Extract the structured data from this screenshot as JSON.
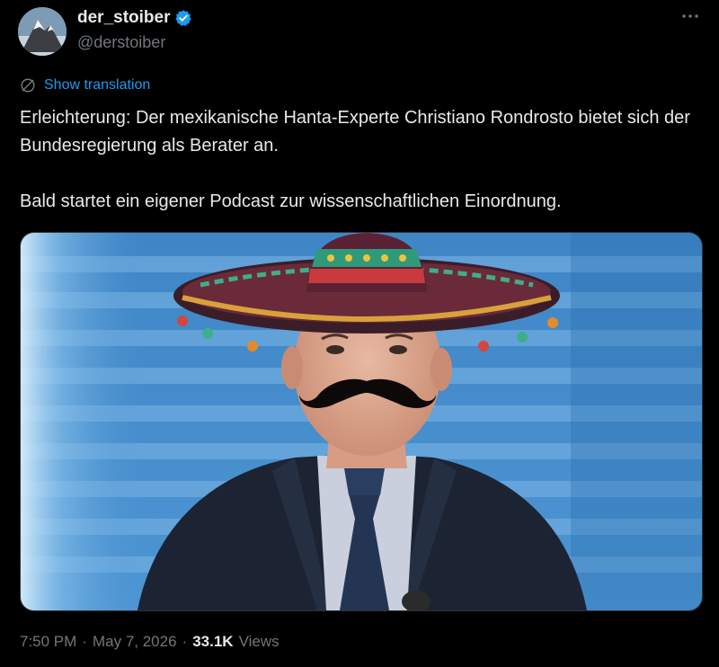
{
  "author": {
    "display_name": "der_stoiber",
    "handle": "@derstoiber",
    "verified": true,
    "avatar_icon": "mountain-avatar-icon"
  },
  "translate_label": "Show translation",
  "tweet_text": "Erleichterung: Der mexikanische Hanta-Experte Christiano Rondrosto bietet sich der Bundesregierung als Berater an.\n\nBald startet ein eigener Podcast zur wissenschaftlichen Einordnung.",
  "meta": {
    "time": "7:50 PM",
    "date": "May 7, 2026",
    "views_count": "33.1K",
    "views_label": "Views"
  },
  "colors": {
    "accent": "#1d9bf0",
    "background": "#000000",
    "muted": "#71767b",
    "text": "#e7e9ea"
  }
}
